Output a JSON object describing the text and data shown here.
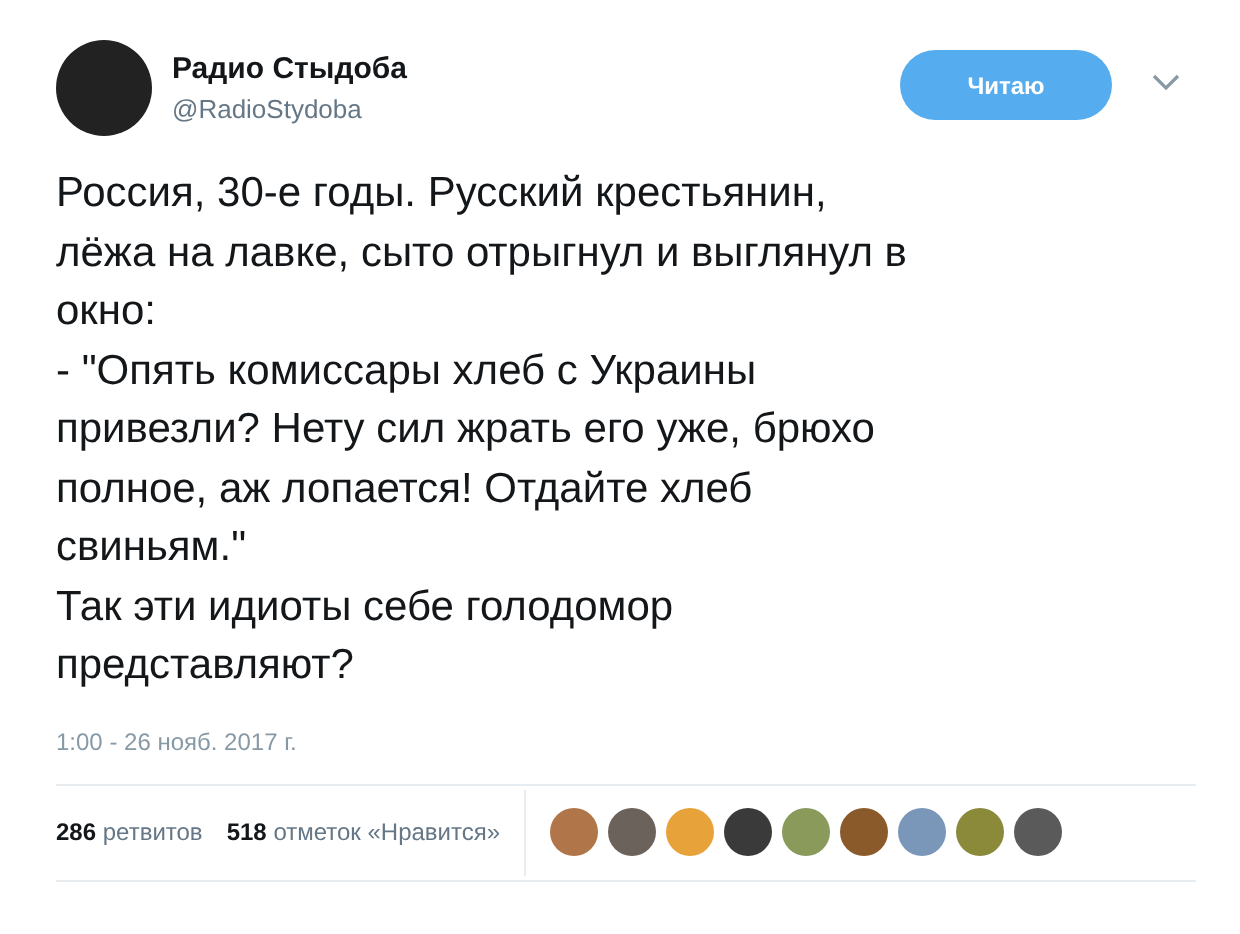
{
  "author": {
    "name": "Радио Стыдоба",
    "handle": "@RadioStydoba"
  },
  "follow_button": "Читаю",
  "tweet_lines": [
    "Россия, 30-е годы. Русский крестьянин,",
    "лёжа на лавке, сыто отрыгнул и выглянул в",
    "окно:",
    "- \"Опять комиссары хлеб с Украины",
    "привезли? Нету сил жрать его уже, брюхо",
    "полное, аж лопается! Отдайте хлеб",
    "свиньям.\"",
    "Так эти идиоты себе голодомор",
    "представляют?"
  ],
  "timestamp": "1:00 - 26 нояб. 2017 г.",
  "stats": [
    {
      "count": "286",
      "label": "ретвитов"
    },
    {
      "count": "518",
      "label": "отметок «Нравится»"
    }
  ],
  "liker_avatars": [
    {
      "color": "#b0764a"
    },
    {
      "color": "#6b625c"
    },
    {
      "color": "#e8a23a"
    },
    {
      "color": "#3a3a3a"
    },
    {
      "color": "#8a9a5a"
    },
    {
      "color": "#8a5a2a"
    },
    {
      "color": "#7a96b8"
    },
    {
      "color": "#8a8a3a"
    },
    {
      "color": "#5a5a5a"
    }
  ]
}
